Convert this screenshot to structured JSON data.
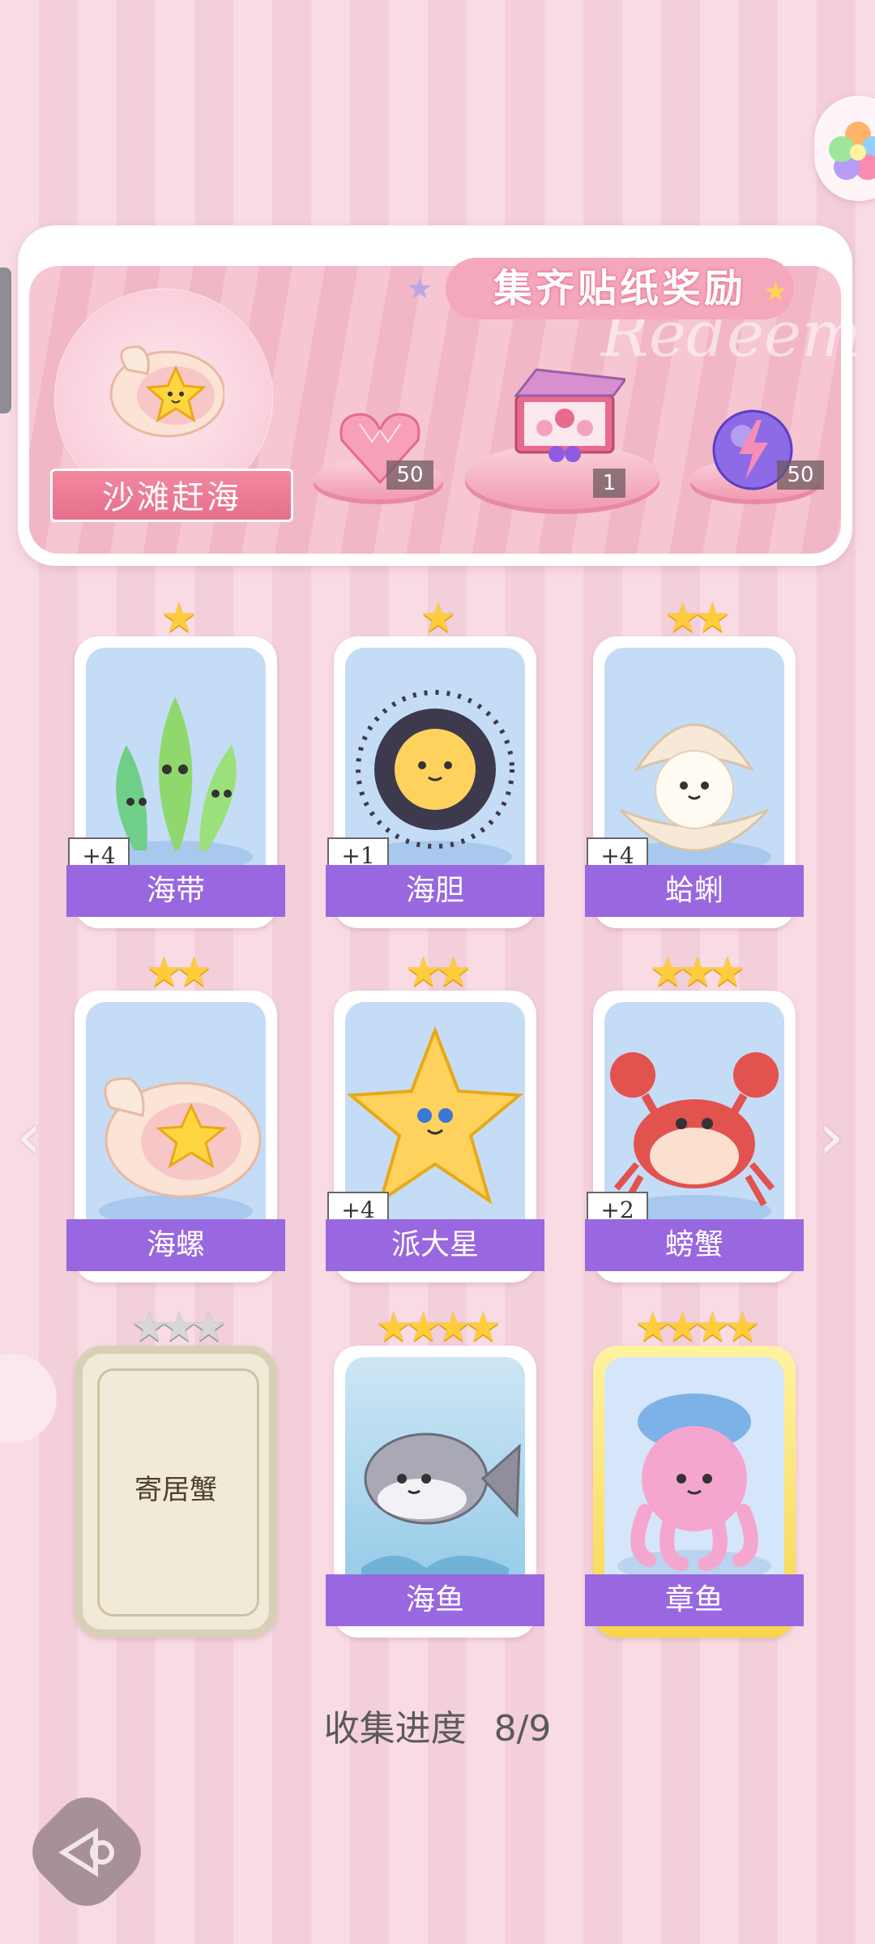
{
  "banner": {
    "title": "集齐贴纸奖励",
    "watermark": "Redeem",
    "event_label": "沙滩赶海",
    "rewards": [
      {
        "icon": "pink-heart-gem-icon",
        "count": "50"
      },
      {
        "icon": "gift-box-icon",
        "count": "1"
      },
      {
        "icon": "purple-lightning-orb-icon",
        "count": "50"
      }
    ]
  },
  "cards": [
    {
      "name": "海带",
      "stars": "★",
      "bonus": "+4",
      "icon": "seaweed-icon",
      "locked": false
    },
    {
      "name": "海胆",
      "stars": "★",
      "bonus": "+1",
      "icon": "sea-urchin-icon",
      "locked": false
    },
    {
      "name": "蛤蜊",
      "stars": "★★",
      "bonus": "+4",
      "icon": "clam-icon",
      "locked": false
    },
    {
      "name": "海螺",
      "stars": "★★",
      "bonus": "",
      "icon": "conch-icon",
      "locked": false
    },
    {
      "name": "派大星",
      "stars": "★★",
      "bonus": "+4",
      "icon": "starfish-icon",
      "locked": false
    },
    {
      "name": "螃蟹",
      "stars": "★★★",
      "bonus": "+2",
      "icon": "crab-icon",
      "locked": false
    },
    {
      "name": "寄居蟹",
      "stars": "★★★",
      "bonus": "",
      "icon": "",
      "locked": true
    },
    {
      "name": "海鱼",
      "stars": "★★★★",
      "bonus": "",
      "icon": "fish-icon",
      "locked": false
    },
    {
      "name": "章鱼",
      "stars": "★★★★",
      "bonus": "",
      "icon": "octopus-icon",
      "locked": false
    }
  ],
  "progress": {
    "label": "收集进度",
    "value": "8/9"
  },
  "nav": {
    "prev": "‹",
    "next": "›"
  },
  "colors": {
    "name_bar": "#9967df",
    "star": "#ffcd3c",
    "background": "#f8dbe3"
  }
}
